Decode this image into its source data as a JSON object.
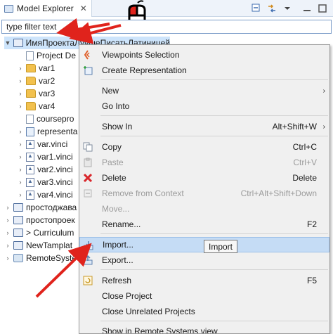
{
  "view": {
    "tab_title": "Model Explorer",
    "close_glyph": "✕",
    "toolbar_icons": [
      "collapse-all-icon",
      "link-with-editor-icon",
      "view-menu-icon",
      "minimize-icon",
      "maximize-icon"
    ]
  },
  "filter": {
    "placeholder": "type filter text",
    "value": "type filter text"
  },
  "tree": {
    "items": [
      {
        "label": "ИмяПроектаЛучшеПисатьЛатиницей",
        "icon": "project-icon",
        "expanded": true
      },
      {
        "label": "Project De",
        "icon": "file-icon"
      },
      {
        "label": "var1",
        "icon": "folder-icon"
      },
      {
        "label": "var2",
        "icon": "folder-icon"
      },
      {
        "label": "var3",
        "icon": "folder-icon"
      },
      {
        "label": "var4",
        "icon": "folder-icon"
      },
      {
        "label": "coursepro",
        "icon": "file-icon"
      },
      {
        "label": "representa",
        "icon": "representation-icon"
      },
      {
        "label": "var.vinci",
        "icon": "vinci-file-icon"
      },
      {
        "label": "var1.vinci",
        "icon": "vinci-file-icon"
      },
      {
        "label": "var2.vinci",
        "icon": "vinci-file-icon"
      },
      {
        "label": "var3.vinci",
        "icon": "vinci-file-icon"
      },
      {
        "label": "var4.vinci",
        "icon": "vinci-file-icon"
      },
      {
        "label": "простоджава",
        "icon": "project-icon"
      },
      {
        "label": "простопроек",
        "icon": "project-icon"
      },
      {
        "label": "> Curriculum",
        "icon": "project-icon"
      },
      {
        "label": "NewTamplat",
        "icon": "project-icon"
      },
      {
        "label": "RemoteSyste",
        "icon": "remote-systems-icon"
      }
    ]
  },
  "context_menu": {
    "items": [
      {
        "label": "Viewpoints Selection",
        "icon": "viewpoints-icon"
      },
      {
        "label": "Create Representation",
        "icon": "create-representation-icon"
      },
      {
        "label": "New",
        "submenu": "›"
      },
      {
        "label": "Go Into"
      },
      {
        "label": "Show In",
        "shortcut": "Alt+Shift+W",
        "submenu": "›"
      },
      {
        "label": "Copy",
        "shortcut": "Ctrl+C",
        "icon": "copy-icon"
      },
      {
        "label": "Paste",
        "shortcut": "Ctrl+V",
        "icon": "paste-icon",
        "disabled": true
      },
      {
        "label": "Delete",
        "shortcut": "Delete",
        "icon": "delete-icon"
      },
      {
        "label": "Remove from Context",
        "shortcut": "Ctrl+Alt+Shift+Down",
        "icon": "remove-context-icon",
        "disabled": true
      },
      {
        "label": "Move...",
        "disabled": true
      },
      {
        "label": "Rename...",
        "shortcut": "F2"
      },
      {
        "label": "Import...",
        "icon": "import-icon",
        "highlighted": true
      },
      {
        "label": "Export...",
        "icon": "export-icon"
      },
      {
        "label": "Refresh",
        "shortcut": "F5",
        "icon": "refresh-icon"
      },
      {
        "label": "Close Project"
      },
      {
        "label": "Close Unrelated Projects"
      },
      {
        "label": "Show in Remote Systems view"
      }
    ]
  },
  "tooltip": {
    "text": "Import"
  },
  "colors": {
    "annotation_arrow": "#e0231c",
    "menu_highlight": "#c5dcf5",
    "selection": "#cde4fb"
  }
}
